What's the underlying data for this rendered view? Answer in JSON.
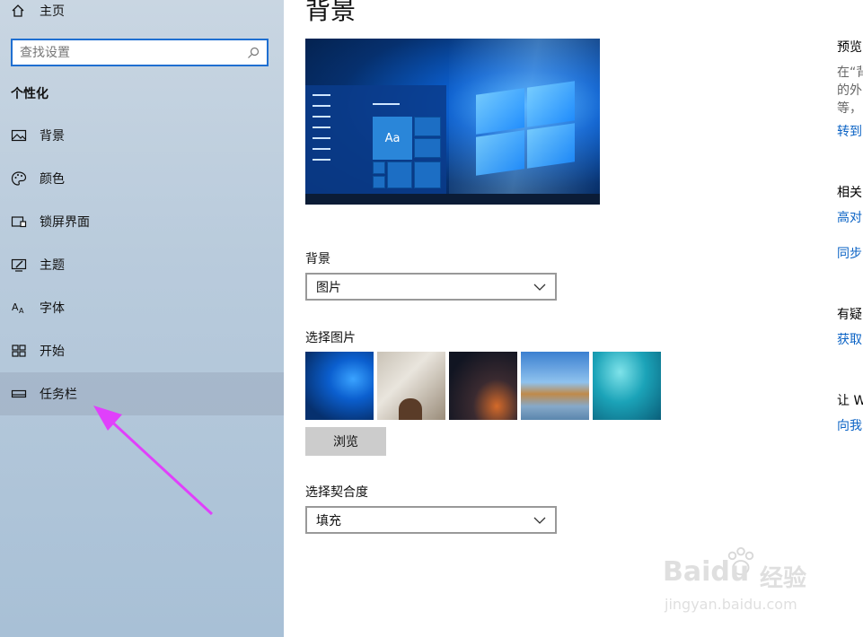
{
  "sidebar": {
    "home_label": "主页",
    "search_placeholder": "查找设置",
    "section_title": "个性化",
    "items": [
      {
        "label": "背景",
        "icon": "image-icon"
      },
      {
        "label": "颜色",
        "icon": "palette-icon"
      },
      {
        "label": "锁屏界面",
        "icon": "lock-screen-icon"
      },
      {
        "label": "主题",
        "icon": "theme-icon"
      },
      {
        "label": "字体",
        "icon": "font-icon"
      },
      {
        "label": "开始",
        "icon": "start-icon"
      },
      {
        "label": "任务栏",
        "icon": "taskbar-icon"
      }
    ],
    "active_item": "任务栏"
  },
  "main": {
    "title": "背景",
    "preview_tile_text": "Aa",
    "background_label": "背景",
    "background_value": "图片",
    "choose_picture_label": "选择图片",
    "browse_button": "浏览",
    "fit_label": "选择契合度",
    "fit_value": "填充"
  },
  "right_panel": {
    "preview_heading": "预览",
    "preview_text_1": "在“背",
    "preview_text_2": "的外",
    "preview_text_3": "等，",
    "preview_link": "转到",
    "related_heading": "相关",
    "related_link_1": "高对",
    "related_link_2": "同步",
    "question_heading": "有疑",
    "question_link": "获取",
    "feedback_heading": "让 W",
    "feedback_link": "向我"
  },
  "watermark": {
    "brand": "Baidu",
    "brand_cn": "经验",
    "url": "jingyan.baidu.com"
  },
  "colors": {
    "accent": "#1f6fd1",
    "link": "#0b63c5",
    "arrow": "#e040fb"
  }
}
